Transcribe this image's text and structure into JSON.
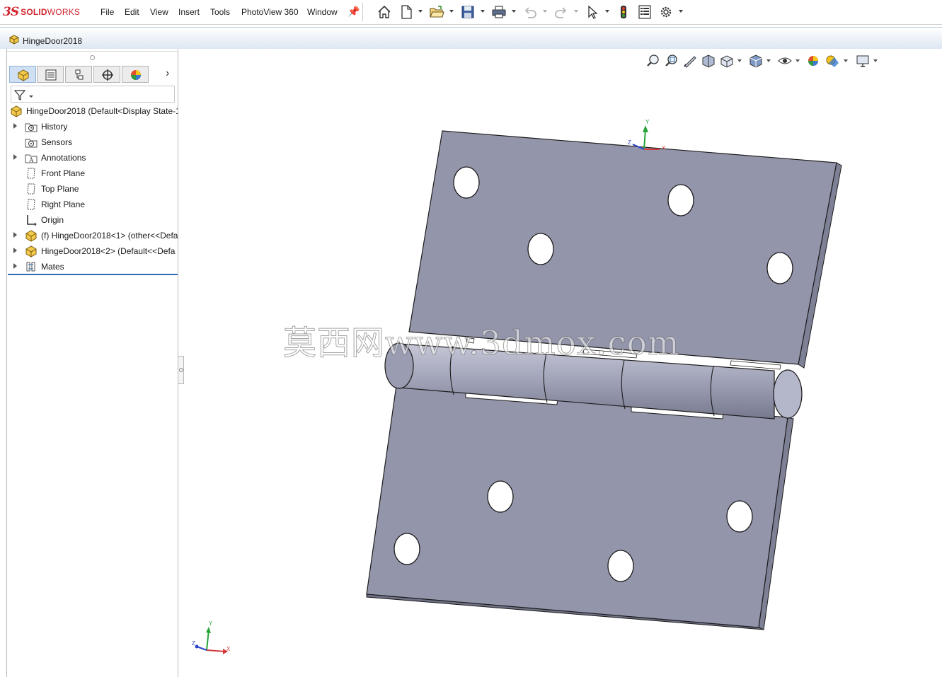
{
  "app": {
    "logo_ds": "3S",
    "logo_brand_bold": "SOLID",
    "logo_brand_light": "WORKS"
  },
  "menu": {
    "items": [
      "File",
      "Edit",
      "View",
      "Insert",
      "Tools",
      "PhotoView 360",
      "Window"
    ]
  },
  "toolbar": {
    "icons": [
      "home-icon",
      "new-document-icon",
      "open-icon",
      "save-icon",
      "print-icon",
      "undo-icon",
      "redo-icon",
      "select-icon",
      "rebuild-icon",
      "file-properties-icon",
      "options-icon"
    ]
  },
  "document": {
    "title": "HingeDoor2018"
  },
  "feature_manager": {
    "tabs": [
      "feature-manager-tab",
      "property-manager-tab",
      "configuration-manager-tab",
      "dimxpert-tab",
      "display-manager-tab"
    ],
    "root": "HingeDoor2018  (Default<Display State-1",
    "items": [
      {
        "label": "History",
        "expandable": true,
        "icon": "history-icon"
      },
      {
        "label": "Sensors",
        "expandable": false,
        "icon": "sensors-icon"
      },
      {
        "label": "Annotations",
        "expandable": true,
        "icon": "annotations-icon"
      },
      {
        "label": "Front Plane",
        "expandable": false,
        "icon": "plane-icon"
      },
      {
        "label": "Top Plane",
        "expandable": false,
        "icon": "plane-icon"
      },
      {
        "label": "Right Plane",
        "expandable": false,
        "icon": "plane-icon"
      },
      {
        "label": "Origin",
        "expandable": false,
        "icon": "origin-icon"
      },
      {
        "label": "(f) HingeDoor2018<1> (other<<Defa",
        "expandable": true,
        "icon": "part-icon"
      },
      {
        "label": "HingeDoor2018<2> (Default<<Defa",
        "expandable": true,
        "icon": "part-icon"
      },
      {
        "label": "Mates",
        "expandable": true,
        "icon": "mates-icon"
      }
    ]
  },
  "heads_up_toolbar": {
    "icons": [
      "zoom-to-fit-icon",
      "zoom-to-area-icon",
      "previous-view-icon",
      "section-view-icon",
      "view-orientation-icon",
      "display-style-icon",
      "hide-show-items-icon",
      "edit-appearance-icon",
      "apply-scene-icon",
      "view-settings-icon"
    ]
  },
  "viewport": {
    "watermark": "莫西网www.3dmox.com",
    "triad_labels": {
      "x": "X",
      "y": "Y",
      "z": "Z"
    }
  },
  "colors": {
    "brand_red": "#d1262f",
    "model_face": "#9395ab",
    "model_edge": "#1c1c1c",
    "panel_accent": "#2a6db5"
  }
}
